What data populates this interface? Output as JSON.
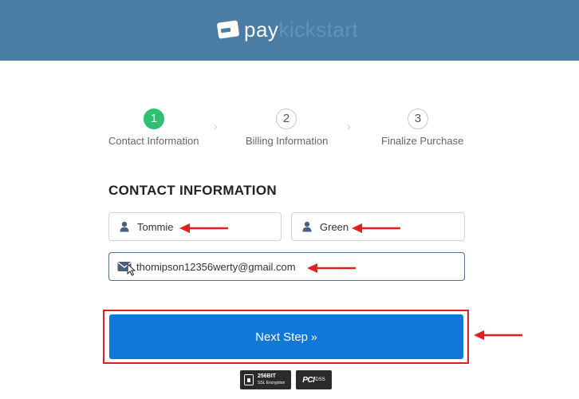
{
  "header": {
    "logo_pay": "pay",
    "logo_rest": "kickstart",
    "background": "#4a7ca4"
  },
  "steps": [
    {
      "number": "1",
      "label": "Contact Information",
      "active": true
    },
    {
      "number": "2",
      "label": "Billing Information",
      "active": false
    },
    {
      "number": "3",
      "label": "Finalize Purchase",
      "active": false
    }
  ],
  "step_separator": "›",
  "contact": {
    "title": "CONTACT INFORMATION",
    "first_name": "Tommie",
    "last_name": "Green",
    "email": "thomipson12356werty@gmail.com"
  },
  "next_button": {
    "label": "Next Step",
    "chevron": "»",
    "color": "#0f78d9"
  },
  "badges": {
    "ssl_line1": "256BIT",
    "ssl_line2": "SSL Encryption",
    "pci_label": "PCI",
    "pci_sub": "DSS"
  },
  "icons": {
    "first_name_icon": "user-icon",
    "last_name_icon": "user-icon",
    "email_icon": "envelope-icon"
  },
  "annotation_color": "#e02020"
}
